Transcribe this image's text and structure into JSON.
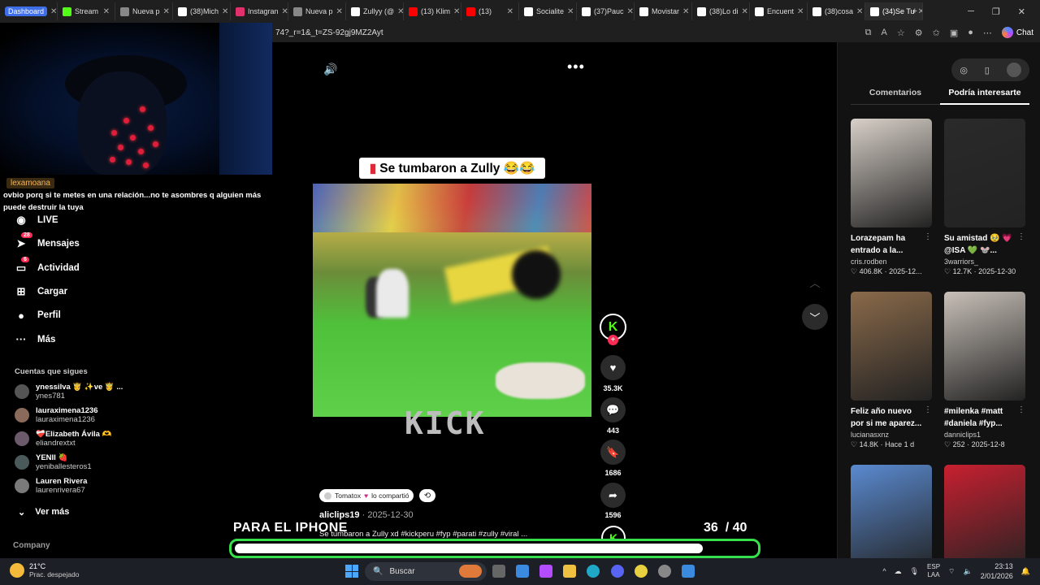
{
  "browser": {
    "tabs": [
      {
        "label": "Dashboard",
        "badge": true,
        "color": "#3e6ee8"
      },
      {
        "label": "Stream",
        "color": "#53fc18"
      },
      {
        "label": "Nueva p",
        "color": "#888888"
      },
      {
        "label": "(38)Mich",
        "color": "#ffffff"
      },
      {
        "label": "Instagran",
        "color": "#e1306c"
      },
      {
        "label": "Nueva p",
        "color": "#888888"
      },
      {
        "label": "Zullyy (@",
        "color": "#ffffff"
      },
      {
        "label": "(13) Klim",
        "color": "#ff0000"
      },
      {
        "label": "(13)",
        "color": "#ff0000"
      },
      {
        "label": "Socialite",
        "color": "#ffffff"
      },
      {
        "label": "(37)Pauc",
        "color": "#ffffff"
      },
      {
        "label": "Movistar",
        "color": "#ffffff"
      },
      {
        "label": "(38)Lo di",
        "color": "#ffffff"
      },
      {
        "label": "Encuent",
        "color": "#ffffff"
      },
      {
        "label": "(38)cosa",
        "color": "#ffffff"
      },
      {
        "label": "(34)Se Tu",
        "color": "#ffffff",
        "active": true
      }
    ],
    "url": "74?_r=1&_t=ZS-92gj9MZ2Ayt",
    "chat_label": "Chat"
  },
  "chat_overlay": {
    "username": "lexamoana",
    "message": "ovbio porq si te metes en una relación...no te asombres q alguien más puede destruir la tuya"
  },
  "sidebar": {
    "nav": [
      {
        "label": "LIVE",
        "icon": "live-icon"
      },
      {
        "label": "Mensajes",
        "icon": "messages-icon",
        "count": "28"
      },
      {
        "label": "Actividad",
        "icon": "activity-icon",
        "count": "6"
      },
      {
        "label": "Cargar",
        "icon": "upload-icon"
      },
      {
        "label": "Perfil",
        "icon": "profile-icon"
      },
      {
        "label": "Más",
        "icon": "more-icon"
      }
    ],
    "following_title": "Cuentas que sigues",
    "following": [
      {
        "name": "ynessilva 🤴 ✨ve 🤴 ...",
        "handle": "ynes781"
      },
      {
        "name": "lauraximena1236",
        "handle": "lauraximena1236"
      },
      {
        "name": "❤️‍🩹Elizabeth Ávila 🫶",
        "handle": "eliandrextxt"
      },
      {
        "name": "YENII 🍓",
        "handle": "yeniballesteros1"
      },
      {
        "name": "Lauren Rivera",
        "handle": "laurenrivera67"
      }
    ],
    "see_more": "Ver más",
    "company": "Company"
  },
  "video": {
    "title_banner": "Se tumbaron a Zully 😂😂",
    "watermark": "KICK",
    "shared_by": "Tomatox",
    "shared_text": "lo compartió",
    "author": "aliclips19",
    "date": "2025-12-30",
    "caption": "Se tumbaron a Zully xd #kickperu #fyp #parati #zully #viral ...",
    "likes": "35.3K",
    "comments": "443",
    "saves": "1686",
    "shares": "1596",
    "creator_initial": "K"
  },
  "overlay": {
    "label": "PARA EL IPHONE",
    "current": "36",
    "total": "/ 40",
    "progress": 0.9
  },
  "right_panel": {
    "tabs": [
      {
        "label": "Comentarios",
        "active": false
      },
      {
        "label": "Podría interesarte",
        "active": true
      }
    ],
    "cards": [
      {
        "title": "Lorazepam ha entrado a la...",
        "user": "cris.rodben",
        "likes": "406.8K",
        "date": "2025-12...",
        "bg": "#d8d0c8"
      },
      {
        "title": "Su amistad 🥹 💗 @ISA 💚 🐭...",
        "user": "3warriors_",
        "likes": "12.7K",
        "date": "2025-12-30",
        "bg": "#2a2a2a"
      },
      {
        "title": "Feliz año nuevo por si me aparez...",
        "user": "lucianasxnz",
        "likes": "14.8K",
        "date": "Hace 1 d",
        "bg": "#8a6a4a"
      },
      {
        "title": "#milenka #matt #daniela #fyp...",
        "user": "danniclips1",
        "likes": "252",
        "date": "2025-12-8",
        "bg": "#c8c0b8"
      },
      {
        "title": "",
        "user": "",
        "likes": "",
        "date": "",
        "bg": "#5a8ad0"
      },
      {
        "title": "",
        "user": "",
        "likes": "",
        "date": "",
        "bg": "#c82030"
      }
    ]
  },
  "taskbar": {
    "temp": "21°C",
    "weather": "Prac. despejado",
    "search": "Buscar",
    "lang1": "ESP",
    "lang2": "LAA",
    "time": "23:13",
    "date": "2/01/2026"
  }
}
